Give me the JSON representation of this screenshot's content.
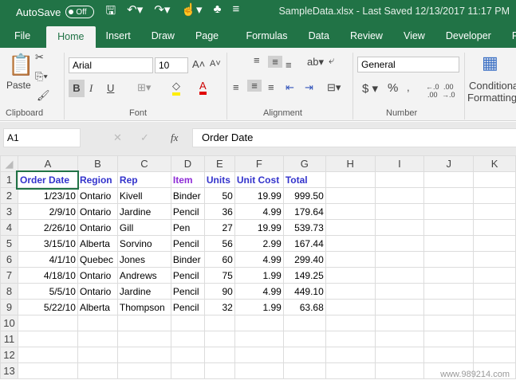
{
  "titlebar": {
    "autosave": "AutoSave",
    "toggle": "Off",
    "doc_title": "SampleData.xlsx  -  Last Saved 12/13/2017 11:17 PM"
  },
  "tabs": [
    "File",
    "Home",
    "Insert",
    "Draw",
    "Page Layout",
    "Formulas",
    "Data",
    "Review",
    "View",
    "Developer",
    "Fox"
  ],
  "ribbon": {
    "paste": "Paste",
    "font_name": "Arial",
    "font_size": "10",
    "number_format": "General",
    "conditional": "Conditional",
    "formatting": "Formatting",
    "groups": {
      "clipboard": "Clipboard",
      "font": "Font",
      "alignment": "Alignment",
      "number": "Number"
    },
    "bold": "B",
    "italic": "I",
    "underline": "U"
  },
  "formula_bar": {
    "name_box": "A1",
    "fx": "fx",
    "content": "Order Date"
  },
  "sheet": {
    "columns": [
      "A",
      "B",
      "C",
      "D",
      "E",
      "F",
      "G",
      "H",
      "I",
      "J",
      "K"
    ],
    "row_numbers": [
      "1",
      "2",
      "3",
      "4",
      "5",
      "6",
      "7",
      "8",
      "9",
      "10",
      "11",
      "12",
      "13"
    ],
    "header": [
      "Order Date",
      "Region",
      "Rep",
      "Item",
      "Units",
      "Unit Cost",
      "Total"
    ],
    "rows": [
      [
        "1/23/10",
        "Ontario",
        "Kivell",
        "Binder",
        "50",
        "19.99",
        "999.50"
      ],
      [
        "2/9/10",
        "Ontario",
        "Jardine",
        "Pencil",
        "36",
        "4.99",
        "179.64"
      ],
      [
        "2/26/10",
        "Ontario",
        "Gill",
        "Pen",
        "27",
        "19.99",
        "539.73"
      ],
      [
        "3/15/10",
        "Alberta",
        "Sorvino",
        "Pencil",
        "56",
        "2.99",
        "167.44"
      ],
      [
        "4/1/10",
        "Quebec",
        "Jones",
        "Binder",
        "60",
        "4.99",
        "299.40"
      ],
      [
        "4/18/10",
        "Ontario",
        "Andrews",
        "Pencil",
        "75",
        "1.99",
        "149.25"
      ],
      [
        "5/5/10",
        "Ontario",
        "Jardine",
        "Pencil",
        "90",
        "4.99",
        "449.10"
      ],
      [
        "5/22/10",
        "Alberta",
        "Thompson",
        "Pencil",
        "32",
        "1.99",
        "63.68"
      ]
    ]
  },
  "watermark": "www.989214.com"
}
